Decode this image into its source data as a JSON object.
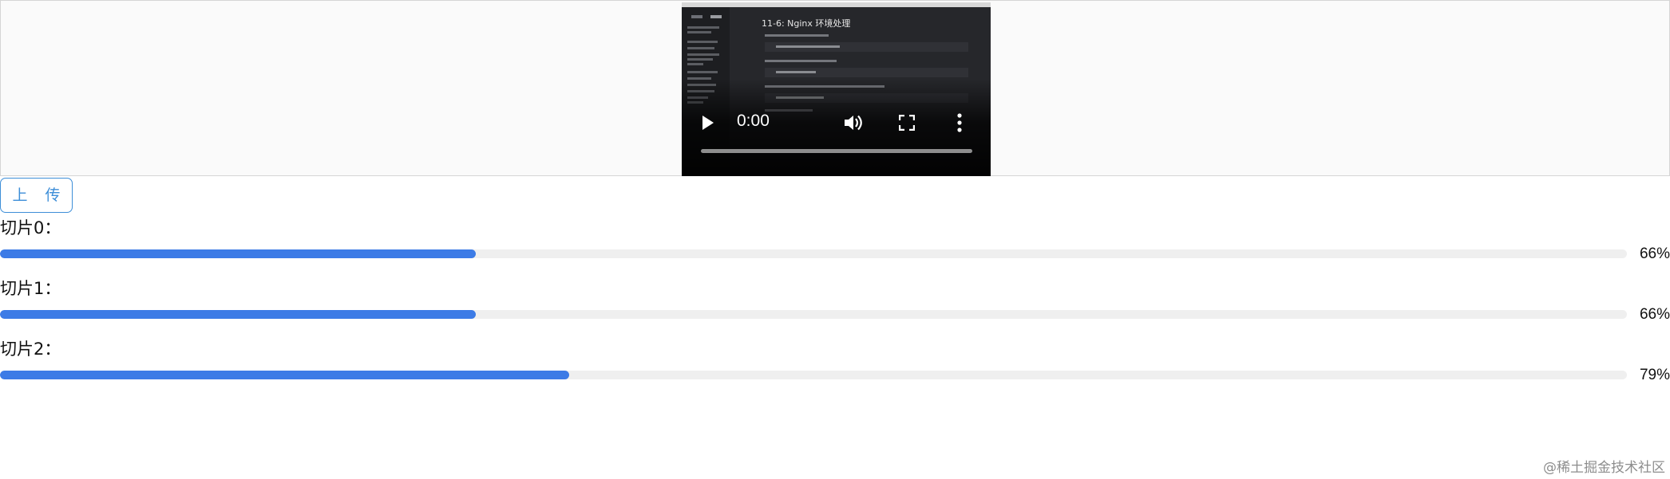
{
  "video": {
    "title": "11-6: Nginx 环境处理",
    "current_time": "0:00",
    "icons": {
      "play": "play-icon",
      "volume": "volume-icon",
      "fullscreen": "fullscreen-icon",
      "more": "more-vertical-icon"
    },
    "progress": 0
  },
  "upload_button": {
    "label": "上 传"
  },
  "slices": [
    {
      "label": "切片0：",
      "percent_label": "66%",
      "percent": 66
    },
    {
      "label": "切片1：",
      "percent_label": "66%",
      "percent": 66
    },
    {
      "label": "切片2：",
      "percent_label": "79%",
      "percent": 79
    }
  ],
  "colors": {
    "accent": "#3c7be6",
    "button_border": "#3d8ed8",
    "track": "#efefef"
  },
  "watermark": "@稀土掘金技术社区"
}
